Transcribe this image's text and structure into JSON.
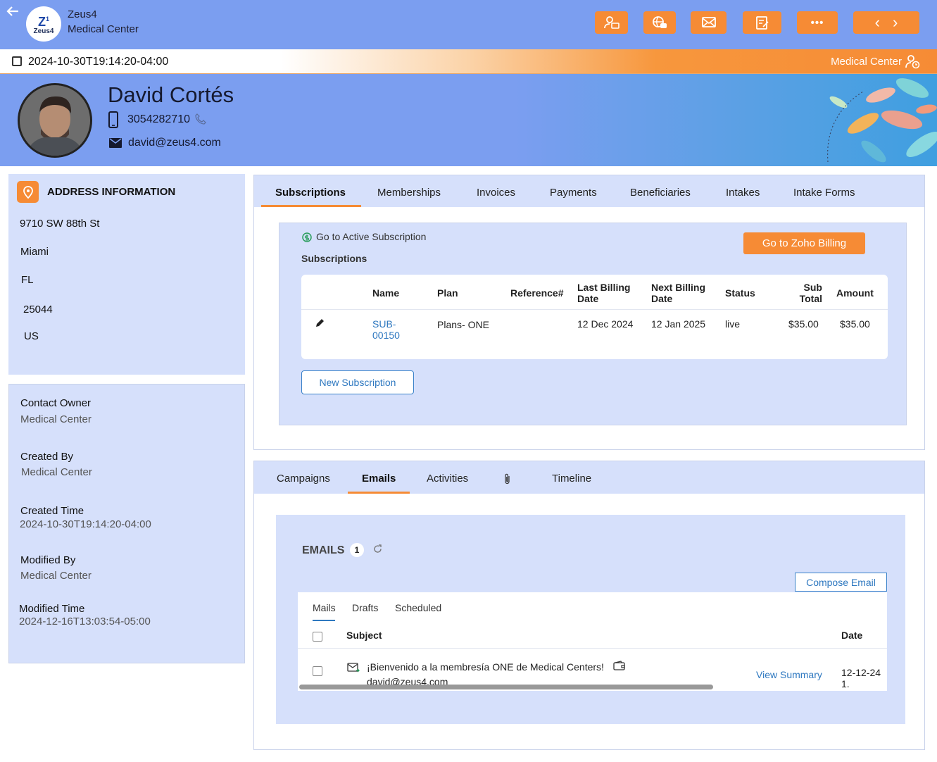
{
  "header": {
    "back_icon": "arrow-left-icon",
    "logo_text": "Zeus4",
    "brand_line1": "Zeus4",
    "brand_line2": "Medical Center",
    "buttons": [
      {
        "name": "contact-card-icon",
        "glyph": "👤"
      },
      {
        "name": "chat-globe-icon",
        "glyph": "🌐"
      },
      {
        "name": "mail-icon",
        "glyph": "✉"
      },
      {
        "name": "edit-note-icon",
        "glyph": "✎"
      },
      {
        "name": "more-icon",
        "glyph": "•••"
      }
    ],
    "nav_prev": "‹",
    "nav_next": "›"
  },
  "strip": {
    "date": "2024-10-30T19:14:20-04:00",
    "org": "Medical Center"
  },
  "profile": {
    "name": "David Cortés",
    "phone": "3054282710",
    "email": "david@zeus4.com"
  },
  "address": {
    "title": "ADDRESS INFORMATION",
    "street": "9710 SW 88th St",
    "city": "Miami",
    "state": "FL",
    "zip": "25044",
    "country": "US"
  },
  "meta": {
    "contact_owner_label": "Contact Owner",
    "contact_owner": "Medical Center",
    "created_by_label": "Created By",
    "created_by": "Medical Center",
    "created_time_label": "Created Time",
    "created_time": "2024-10-30T19:14:20-04:00",
    "modified_by_label": "Modified By",
    "modified_by": "Medical Center",
    "modified_time_label": "Modified Time",
    "modified_time": "2024-12-16T13:03:54-05:00"
  },
  "subs_tabs": [
    "Subscriptions",
    "Memberships",
    "Invoices",
    "Payments",
    "Beneficiaries",
    "Intakes",
    "Intake Forms"
  ],
  "subs": {
    "go_active": "Go to Active Subscription",
    "section_label": "Subscriptions",
    "zoho_button": "Go to Zoho Billing",
    "new_button": "New Subscription",
    "columns": {
      "name": "Name",
      "plan": "Plan",
      "reference": "Reference#",
      "last_billing_1": "Last Billing",
      "last_billing_2": "Date",
      "next_billing_1": "Next Billing",
      "next_billing_2": "Date",
      "status": "Status",
      "subtotal_1": "Sub",
      "subtotal_2": "Total",
      "amount": "Amount"
    },
    "row": {
      "name_1": "SUB-",
      "name_2": "00150",
      "plan": "Plans- ONE",
      "reference": "",
      "last_billing": "12 Dec 2024",
      "next_billing": "12 Jan 2025",
      "status": "live",
      "subtotal": "$35.00",
      "amount": "$35.00"
    }
  },
  "email_tabs": [
    "Campaigns",
    "Emails",
    "Activities",
    "Timeline"
  ],
  "emails": {
    "title": "EMAILS",
    "count": "1",
    "compose": "Compose Email",
    "mail_tabs": [
      "Mails",
      "Drafts",
      "Scheduled"
    ],
    "col_subject": "Subject",
    "col_date": "Date",
    "row": {
      "subject": "¡Bienvenido a la membresía ONE de Medical Centers!",
      "from": "david@zeus4.com",
      "view": "View Summary",
      "date": "12-12-24 1."
    }
  }
}
